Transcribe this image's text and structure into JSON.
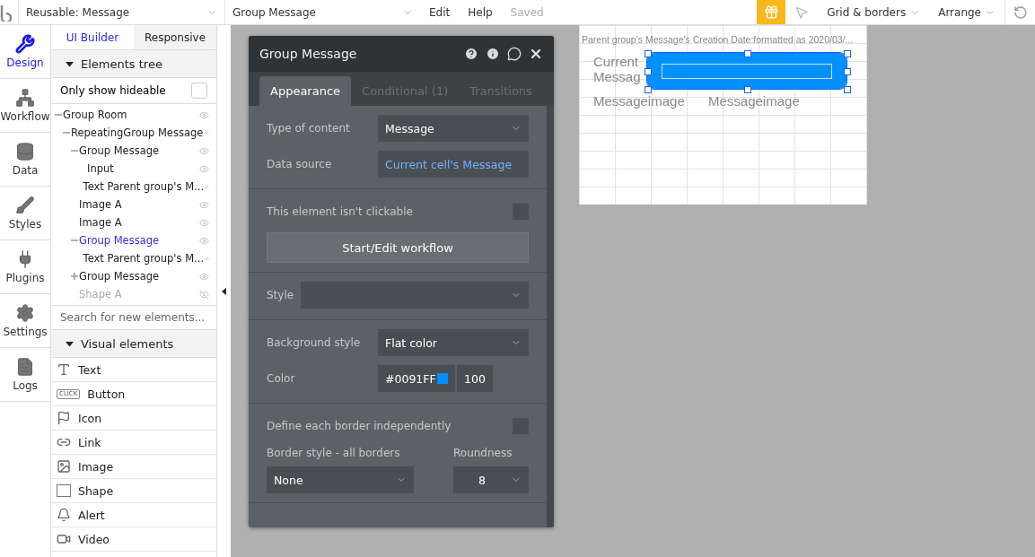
{
  "topbar": {
    "page": "Reusable: Message",
    "element": "Group Message",
    "menu": [
      "Edit",
      "Help"
    ],
    "status": "Saved",
    "tools": [
      "Grid & borders",
      "Arrange"
    ]
  },
  "nav": [
    {
      "label": "Design",
      "selected": true
    },
    {
      "label": "Workflow",
      "selected": false
    },
    {
      "label": "Data",
      "selected": false
    },
    {
      "label": "Styles",
      "selected": false
    },
    {
      "label": "Plugins",
      "selected": false
    },
    {
      "label": "Settings",
      "selected": false
    },
    {
      "label": "Logs",
      "selected": false
    }
  ],
  "panel_tabs": [
    {
      "label": "UI Builder",
      "selected": true
    },
    {
      "label": "Responsive",
      "selected": false
    }
  ],
  "tree": {
    "title": "Elements tree",
    "expanded": true,
    "filter": {
      "label": "Only show hideable",
      "checked": false
    },
    "nodes": [
      {
        "label": "Group Room",
        "expanded": true,
        "selected": false,
        "hidden": false,
        "children": [
          {
            "label": "RepeatingGroup Message",
            "expanded": true,
            "selected": false,
            "hidden": false,
            "children": [
              {
                "label": "Group Message",
                "expanded": true,
                "selected": false,
                "hidden": false,
                "children": [
                  {
                    "label": "Input",
                    "selected": false,
                    "hidden": false
                  },
                  {
                    "label": "Text Parent group's M...",
                    "selected": false,
                    "hidden": false
                  }
                ]
              },
              {
                "label": "Image A",
                "selected": false,
                "hidden": false
              },
              {
                "label": "Image A",
                "selected": false,
                "hidden": false
              },
              {
                "label": "Group Message",
                "expanded": true,
                "selected": true,
                "hidden": false,
                "children": [
                  {
                    "label": "Text Parent group's M...",
                    "selected": false,
                    "hidden": false
                  }
                ]
              },
              {
                "label": "Group Message",
                "expanded": false,
                "selected": false,
                "hidden": false
              },
              {
                "label": "Shape A",
                "selected": false,
                "hidden": true
              }
            ]
          }
        ]
      }
    ]
  },
  "search": {
    "placeholder": "Search for new elements..."
  },
  "visual": {
    "title": "Visual elements",
    "expanded": true,
    "items": [
      {
        "label": "Text"
      },
      {
        "label": "Button",
        "badge": "CLICK"
      },
      {
        "label": "Icon"
      },
      {
        "label": "Link"
      },
      {
        "label": "Image"
      },
      {
        "label": "Shape"
      },
      {
        "label": "Alert"
      },
      {
        "label": "Video"
      }
    ]
  },
  "editor": {
    "title": "Group Message",
    "tabs": [
      {
        "label": "Appearance",
        "selected": true
      },
      {
        "label": "Conditional (1)",
        "selected": false
      },
      {
        "label": "Transitions",
        "selected": false
      }
    ],
    "sections": [
      [
        {
          "kind": "select",
          "label": "Type of content",
          "value": "Message"
        },
        {
          "kind": "expression",
          "label": "Data source",
          "value": "Current cell's Message"
        }
      ],
      [
        {
          "kind": "checkbox",
          "label": "This element isn't clickable",
          "checked": false
        },
        {
          "kind": "button",
          "label": "Start/Edit workflow"
        }
      ],
      [
        {
          "kind": "select",
          "label": "Style"
        }
      ],
      [
        {
          "kind": "select",
          "label": "Background style",
          "value": "Flat color"
        },
        {
          "kind": "color",
          "label": "Color",
          "value": "#0091FF",
          "color": "#0091ff",
          "opacity": "100"
        }
      ],
      [
        {
          "kind": "checkbox",
          "label": "Define each border independently",
          "checked": false
        },
        {
          "kind": "pair",
          "label": "Border style - all borders",
          "value": "None",
          "label2": "Roundness",
          "value2": "8"
        }
      ]
    ]
  },
  "canvas": {
    "header": "Parent group's Message's Creation Date:formatted as 2020/03/...",
    "texts": [
      "Current",
      "Messag",
      "Messageimage",
      "Messageimage"
    ],
    "input": {
      "selected": true,
      "color": "#0091ff"
    }
  }
}
